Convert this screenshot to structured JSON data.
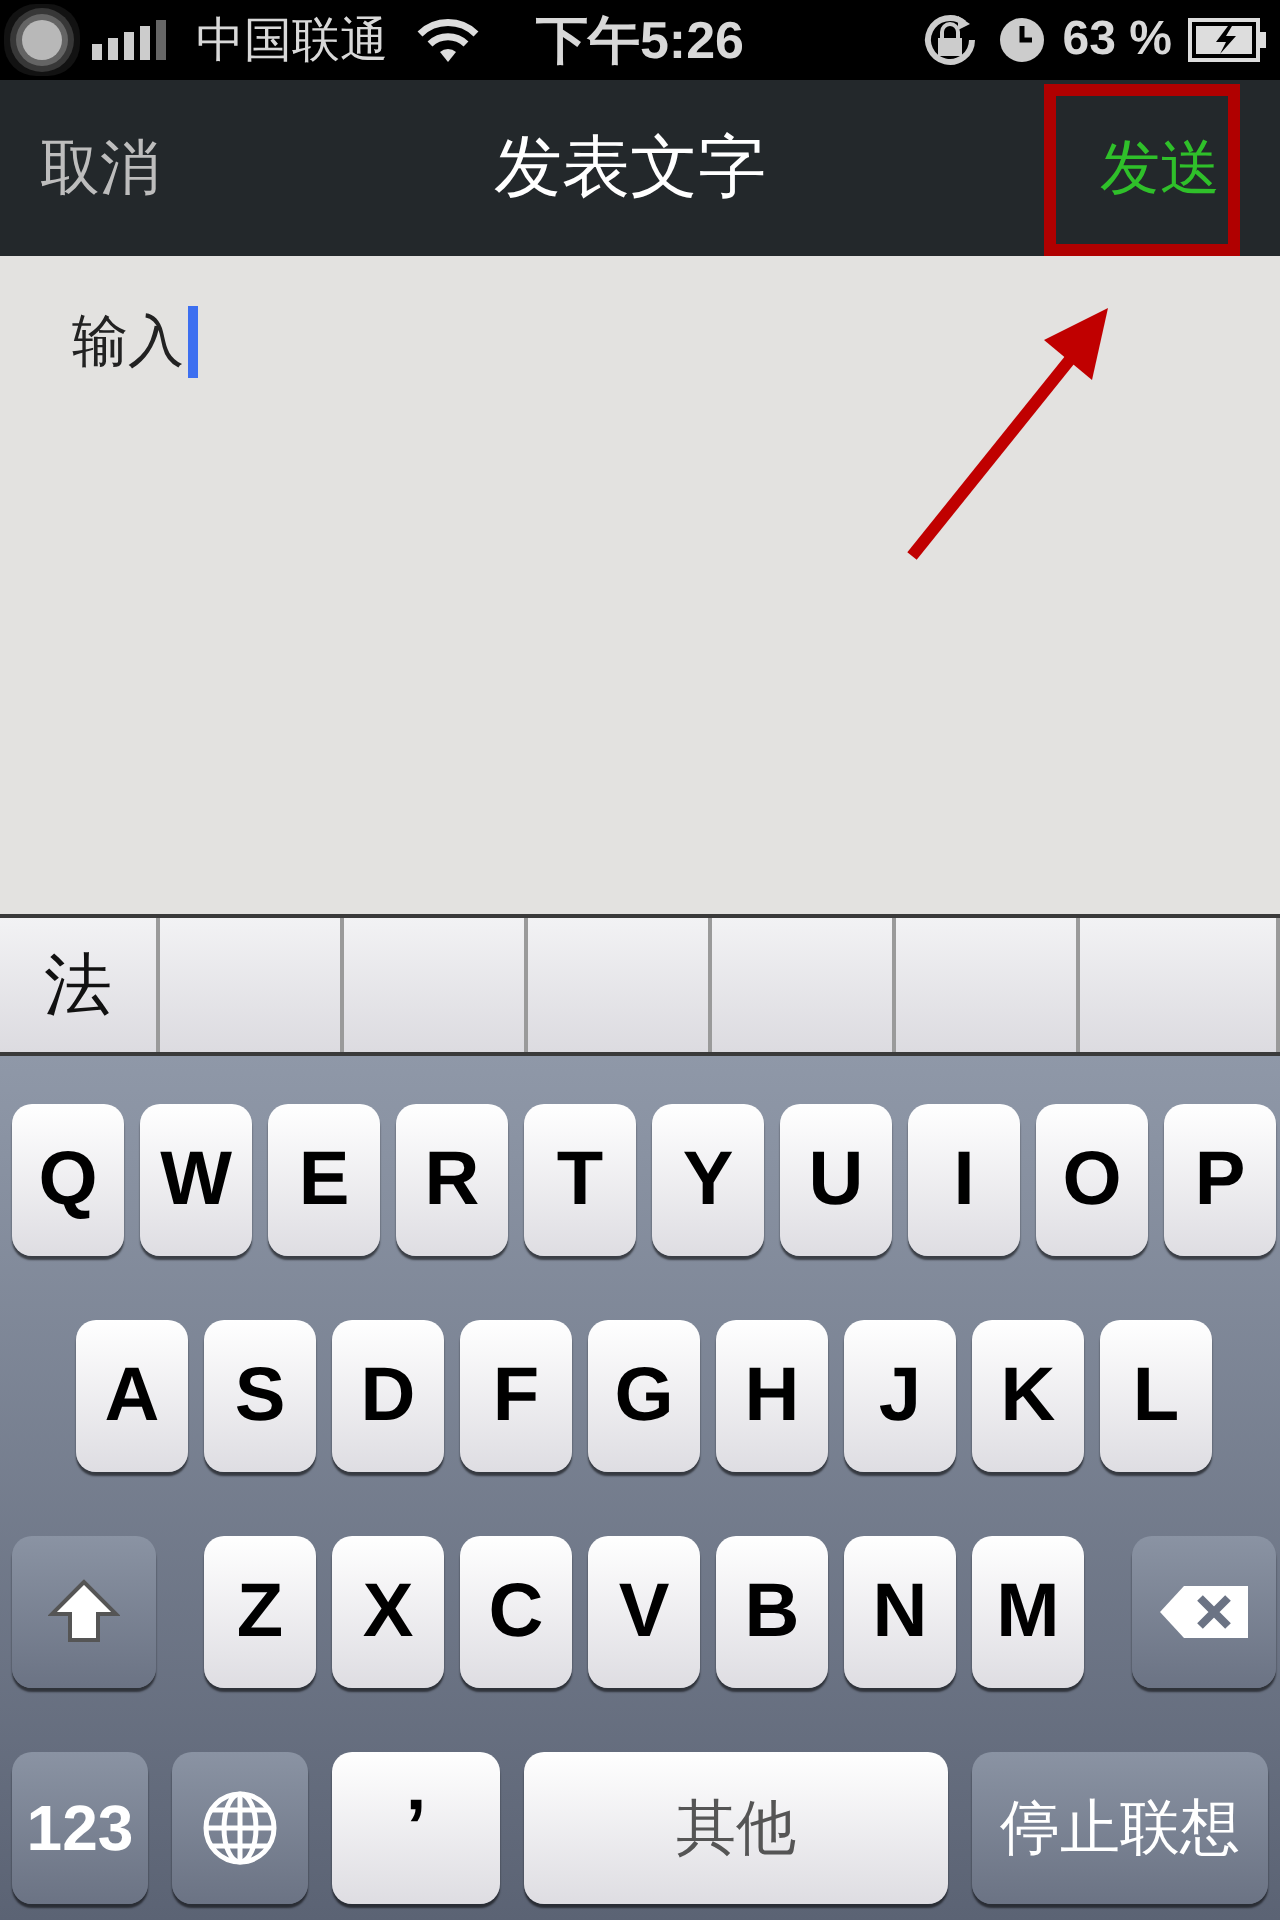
{
  "status_bar": {
    "carrier": "中国联通",
    "time": "下午5:26",
    "battery": "63 %"
  },
  "nav": {
    "cancel": "取消",
    "title": "发表文字",
    "send": "发送"
  },
  "compose": {
    "value": "输入"
  },
  "candidates": [
    "法"
  ],
  "keyboard": {
    "rows": [
      [
        "Q",
        "W",
        "E",
        "R",
        "T",
        "Y",
        "U",
        "I",
        "O",
        "P"
      ],
      [
        "A",
        "S",
        "D",
        "F",
        "G",
        "H",
        "J",
        "K",
        "L"
      ],
      [
        "Z",
        "X",
        "C",
        "V",
        "B",
        "N",
        "M"
      ]
    ],
    "bottom": [
      {
        "kind": "text",
        "label": "123"
      },
      {
        "kind": "globe"
      },
      {
        "kind": "text",
        "label": "’"
      },
      {
        "kind": "space",
        "label": "其他"
      },
      {
        "kind": "return",
        "label": "停止联想"
      }
    ]
  }
}
